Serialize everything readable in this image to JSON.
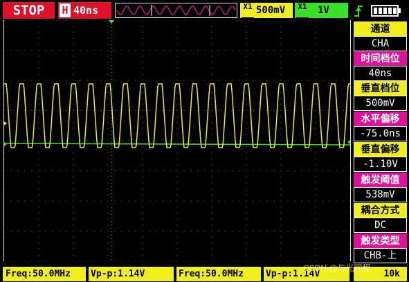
{
  "header": {
    "run_state": "STOP",
    "timebase_prefix": "H",
    "timebase_value": "40ns",
    "ch1_prefix": "X1",
    "ch1_volt": "500mV",
    "ch2_prefix": "X1",
    "ch2_volt": "1V",
    "trigger_icon": "trigger-rising-edge-icon",
    "battery_icon": "battery-full-icon"
  },
  "sidebar": [
    {
      "label": "通道",
      "value": "CHA",
      "style": "yellow"
    },
    {
      "label": "时间档位",
      "value": "40ns",
      "style": "magenta"
    },
    {
      "label": "垂直档位",
      "value": "500mV",
      "style": "yellow"
    },
    {
      "label": "水平偏移",
      "value": "-75.0ns",
      "style": "magenta"
    },
    {
      "label": "垂直偏移",
      "value": "-1.10V",
      "style": "yellow"
    },
    {
      "label": "触发阈值",
      "value": "538mV",
      "style": "magenta"
    },
    {
      "label": "耦合方式",
      "value": "DC",
      "style": "yellow"
    },
    {
      "label": "触发类型",
      "value": "CHB-上",
      "style": "magenta"
    }
  ],
  "measurements": {
    "m1": "Freq:50.0MHz",
    "m2": "Vp-p:1.14V",
    "m3": "Freq:50.0MHz",
    "m4": "Vp-p:1.14V",
    "bottom_right": "10k"
  },
  "waveform": {
    "ch1_color": "#f0ef1a",
    "ch2_color": "#3adf2a",
    "cycles_on_screen": 20
  },
  "watermark": "CSDN @与光同程"
}
